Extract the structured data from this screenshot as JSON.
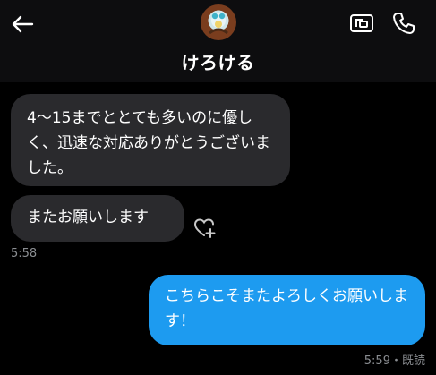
{
  "header": {
    "contact_name": "けろける",
    "icons": [
      "back-arrow-icon",
      "video-call-icon",
      "phone-icon"
    ]
  },
  "messages": [
    {
      "direction": "incoming",
      "text": "4〜15までととても多いのに優しく、迅速な対応ありがとうございました。"
    },
    {
      "direction": "incoming",
      "text": "またお願いします"
    },
    {
      "direction": "outgoing",
      "text": "こちらこそまたよろしくお願いします！"
    }
  ],
  "timestamps": {
    "incoming": "5:58",
    "outgoing": "5:59",
    "separator": "・",
    "read_status": "既読"
  },
  "colors": {
    "background": "#000000",
    "incoming_bubble": "#2a2a2d",
    "outgoing_bubble": "#1d9bf0",
    "meta_text": "#8a8d91"
  }
}
